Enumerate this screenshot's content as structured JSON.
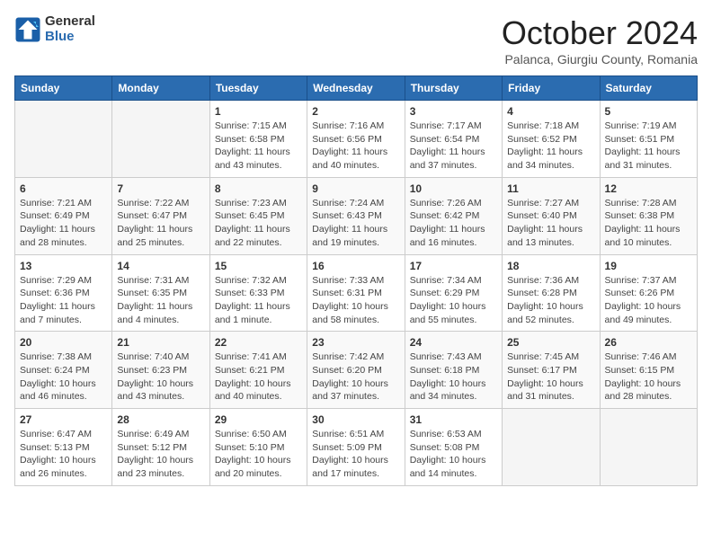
{
  "logo": {
    "general": "General",
    "blue": "Blue"
  },
  "title": "October 2024",
  "subtitle": "Palanca, Giurgiu County, Romania",
  "headers": [
    "Sunday",
    "Monday",
    "Tuesday",
    "Wednesday",
    "Thursday",
    "Friday",
    "Saturday"
  ],
  "weeks": [
    [
      {
        "day": "",
        "sunrise": "",
        "sunset": "",
        "daylight": ""
      },
      {
        "day": "",
        "sunrise": "",
        "sunset": "",
        "daylight": ""
      },
      {
        "day": "1",
        "sunrise": "Sunrise: 7:15 AM",
        "sunset": "Sunset: 6:58 PM",
        "daylight": "Daylight: 11 hours and 43 minutes."
      },
      {
        "day": "2",
        "sunrise": "Sunrise: 7:16 AM",
        "sunset": "Sunset: 6:56 PM",
        "daylight": "Daylight: 11 hours and 40 minutes."
      },
      {
        "day": "3",
        "sunrise": "Sunrise: 7:17 AM",
        "sunset": "Sunset: 6:54 PM",
        "daylight": "Daylight: 11 hours and 37 minutes."
      },
      {
        "day": "4",
        "sunrise": "Sunrise: 7:18 AM",
        "sunset": "Sunset: 6:52 PM",
        "daylight": "Daylight: 11 hours and 34 minutes."
      },
      {
        "day": "5",
        "sunrise": "Sunrise: 7:19 AM",
        "sunset": "Sunset: 6:51 PM",
        "daylight": "Daylight: 11 hours and 31 minutes."
      }
    ],
    [
      {
        "day": "6",
        "sunrise": "Sunrise: 7:21 AM",
        "sunset": "Sunset: 6:49 PM",
        "daylight": "Daylight: 11 hours and 28 minutes."
      },
      {
        "day": "7",
        "sunrise": "Sunrise: 7:22 AM",
        "sunset": "Sunset: 6:47 PM",
        "daylight": "Daylight: 11 hours and 25 minutes."
      },
      {
        "day": "8",
        "sunrise": "Sunrise: 7:23 AM",
        "sunset": "Sunset: 6:45 PM",
        "daylight": "Daylight: 11 hours and 22 minutes."
      },
      {
        "day": "9",
        "sunrise": "Sunrise: 7:24 AM",
        "sunset": "Sunset: 6:43 PM",
        "daylight": "Daylight: 11 hours and 19 minutes."
      },
      {
        "day": "10",
        "sunrise": "Sunrise: 7:26 AM",
        "sunset": "Sunset: 6:42 PM",
        "daylight": "Daylight: 11 hours and 16 minutes."
      },
      {
        "day": "11",
        "sunrise": "Sunrise: 7:27 AM",
        "sunset": "Sunset: 6:40 PM",
        "daylight": "Daylight: 11 hours and 13 minutes."
      },
      {
        "day": "12",
        "sunrise": "Sunrise: 7:28 AM",
        "sunset": "Sunset: 6:38 PM",
        "daylight": "Daylight: 11 hours and 10 minutes."
      }
    ],
    [
      {
        "day": "13",
        "sunrise": "Sunrise: 7:29 AM",
        "sunset": "Sunset: 6:36 PM",
        "daylight": "Daylight: 11 hours and 7 minutes."
      },
      {
        "day": "14",
        "sunrise": "Sunrise: 7:31 AM",
        "sunset": "Sunset: 6:35 PM",
        "daylight": "Daylight: 11 hours and 4 minutes."
      },
      {
        "day": "15",
        "sunrise": "Sunrise: 7:32 AM",
        "sunset": "Sunset: 6:33 PM",
        "daylight": "Daylight: 11 hours and 1 minute."
      },
      {
        "day": "16",
        "sunrise": "Sunrise: 7:33 AM",
        "sunset": "Sunset: 6:31 PM",
        "daylight": "Daylight: 10 hours and 58 minutes."
      },
      {
        "day": "17",
        "sunrise": "Sunrise: 7:34 AM",
        "sunset": "Sunset: 6:29 PM",
        "daylight": "Daylight: 10 hours and 55 minutes."
      },
      {
        "day": "18",
        "sunrise": "Sunrise: 7:36 AM",
        "sunset": "Sunset: 6:28 PM",
        "daylight": "Daylight: 10 hours and 52 minutes."
      },
      {
        "day": "19",
        "sunrise": "Sunrise: 7:37 AM",
        "sunset": "Sunset: 6:26 PM",
        "daylight": "Daylight: 10 hours and 49 minutes."
      }
    ],
    [
      {
        "day": "20",
        "sunrise": "Sunrise: 7:38 AM",
        "sunset": "Sunset: 6:24 PM",
        "daylight": "Daylight: 10 hours and 46 minutes."
      },
      {
        "day": "21",
        "sunrise": "Sunrise: 7:40 AM",
        "sunset": "Sunset: 6:23 PM",
        "daylight": "Daylight: 10 hours and 43 minutes."
      },
      {
        "day": "22",
        "sunrise": "Sunrise: 7:41 AM",
        "sunset": "Sunset: 6:21 PM",
        "daylight": "Daylight: 10 hours and 40 minutes."
      },
      {
        "day": "23",
        "sunrise": "Sunrise: 7:42 AM",
        "sunset": "Sunset: 6:20 PM",
        "daylight": "Daylight: 10 hours and 37 minutes."
      },
      {
        "day": "24",
        "sunrise": "Sunrise: 7:43 AM",
        "sunset": "Sunset: 6:18 PM",
        "daylight": "Daylight: 10 hours and 34 minutes."
      },
      {
        "day": "25",
        "sunrise": "Sunrise: 7:45 AM",
        "sunset": "Sunset: 6:17 PM",
        "daylight": "Daylight: 10 hours and 31 minutes."
      },
      {
        "day": "26",
        "sunrise": "Sunrise: 7:46 AM",
        "sunset": "Sunset: 6:15 PM",
        "daylight": "Daylight: 10 hours and 28 minutes."
      }
    ],
    [
      {
        "day": "27",
        "sunrise": "Sunrise: 6:47 AM",
        "sunset": "Sunset: 5:13 PM",
        "daylight": "Daylight: 10 hours and 26 minutes."
      },
      {
        "day": "28",
        "sunrise": "Sunrise: 6:49 AM",
        "sunset": "Sunset: 5:12 PM",
        "daylight": "Daylight: 10 hours and 23 minutes."
      },
      {
        "day": "29",
        "sunrise": "Sunrise: 6:50 AM",
        "sunset": "Sunset: 5:10 PM",
        "daylight": "Daylight: 10 hours and 20 minutes."
      },
      {
        "day": "30",
        "sunrise": "Sunrise: 6:51 AM",
        "sunset": "Sunset: 5:09 PM",
        "daylight": "Daylight: 10 hours and 17 minutes."
      },
      {
        "day": "31",
        "sunrise": "Sunrise: 6:53 AM",
        "sunset": "Sunset: 5:08 PM",
        "daylight": "Daylight: 10 hours and 14 minutes."
      },
      {
        "day": "",
        "sunrise": "",
        "sunset": "",
        "daylight": ""
      },
      {
        "day": "",
        "sunrise": "",
        "sunset": "",
        "daylight": ""
      }
    ]
  ]
}
